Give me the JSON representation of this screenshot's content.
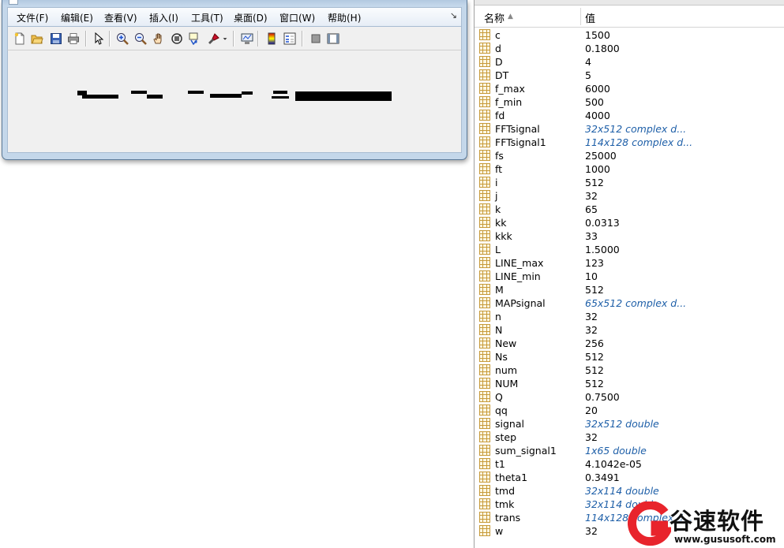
{
  "figure_window": {
    "menu": [
      {
        "label": "文件(F)"
      },
      {
        "label": "编辑(E)"
      },
      {
        "label": "查看(V)"
      },
      {
        "label": "插入(I)"
      },
      {
        "label": "工具(T)"
      },
      {
        "label": "桌面(D)"
      },
      {
        "label": "窗口(W)"
      },
      {
        "label": "帮助(H)"
      }
    ],
    "menu_overflow": "↘",
    "toolbar_icons": [
      "new-figure-icon",
      "open-file-icon",
      "save-icon",
      "print-icon",
      "edit-plot-arrow-icon",
      "zoom-in-icon",
      "zoom-out-icon",
      "pan-hand-icon",
      "rotate-3d-icon",
      "data-cursor-icon",
      "brush-icon",
      "brush-dropdown-icon",
      "link-plot-icon",
      "insert-colorbar-icon",
      "insert-legend-icon",
      "hide-plot-tools-icon",
      "show-plot-tools-icon"
    ]
  },
  "workspace": {
    "header": {
      "name": "名称",
      "sort_indicator": "▲",
      "value": "值"
    },
    "rows": [
      {
        "name": "c",
        "value": "1500",
        "italic": false
      },
      {
        "name": "d",
        "value": "0.1800",
        "italic": false
      },
      {
        "name": "D",
        "value": "4",
        "italic": false
      },
      {
        "name": "DT",
        "value": "5",
        "italic": false
      },
      {
        "name": "f_max",
        "value": "6000",
        "italic": false
      },
      {
        "name": "f_min",
        "value": "500",
        "italic": false
      },
      {
        "name": "fd",
        "value": "4000",
        "italic": false
      },
      {
        "name": "FFTsignal",
        "value": "32x512 complex d...",
        "italic": true
      },
      {
        "name": "FFTsignal1",
        "value": "114x128 complex d...",
        "italic": true
      },
      {
        "name": "fs",
        "value": "25000",
        "italic": false
      },
      {
        "name": "ft",
        "value": "1000",
        "italic": false
      },
      {
        "name": "i",
        "value": "512",
        "italic": false
      },
      {
        "name": "j",
        "value": "32",
        "italic": false
      },
      {
        "name": "k",
        "value": "65",
        "italic": false
      },
      {
        "name": "kk",
        "value": "0.0313",
        "italic": false
      },
      {
        "name": "kkk",
        "value": "33",
        "italic": false
      },
      {
        "name": "L",
        "value": "1.5000",
        "italic": false
      },
      {
        "name": "LINE_max",
        "value": "123",
        "italic": false
      },
      {
        "name": "LINE_min",
        "value": "10",
        "italic": false
      },
      {
        "name": "M",
        "value": "512",
        "italic": false
      },
      {
        "name": "MAPsignal",
        "value": "65x512 complex d...",
        "italic": true
      },
      {
        "name": "n",
        "value": "32",
        "italic": false
      },
      {
        "name": "N",
        "value": "32",
        "italic": false
      },
      {
        "name": "New",
        "value": "256",
        "italic": false
      },
      {
        "name": "Ns",
        "value": "512",
        "italic": false
      },
      {
        "name": "num",
        "value": "512",
        "italic": false
      },
      {
        "name": "NUM",
        "value": "512",
        "italic": false
      },
      {
        "name": "Q",
        "value": "0.7500",
        "italic": false
      },
      {
        "name": "qq",
        "value": "20",
        "italic": false
      },
      {
        "name": "signal",
        "value": "32x512 double",
        "italic": true
      },
      {
        "name": "step",
        "value": "32",
        "italic": false
      },
      {
        "name": "sum_signal1",
        "value": "1x65 double",
        "italic": true
      },
      {
        "name": "t1",
        "value": "4.1042e-05",
        "italic": false
      },
      {
        "name": "theta1",
        "value": "0.3491",
        "italic": false
      },
      {
        "name": "tmd",
        "value": "32x114 double",
        "italic": true
      },
      {
        "name": "tmk",
        "value": "32x114 double",
        "italic": true
      },
      {
        "name": "trans",
        "value": "114x128 complex d...",
        "italic": true
      },
      {
        "name": "w",
        "value": "32",
        "italic": false
      }
    ]
  },
  "watermark": {
    "title": "谷速软件",
    "url": "www.gususoft.com",
    "brand_color": "#e8242c"
  }
}
